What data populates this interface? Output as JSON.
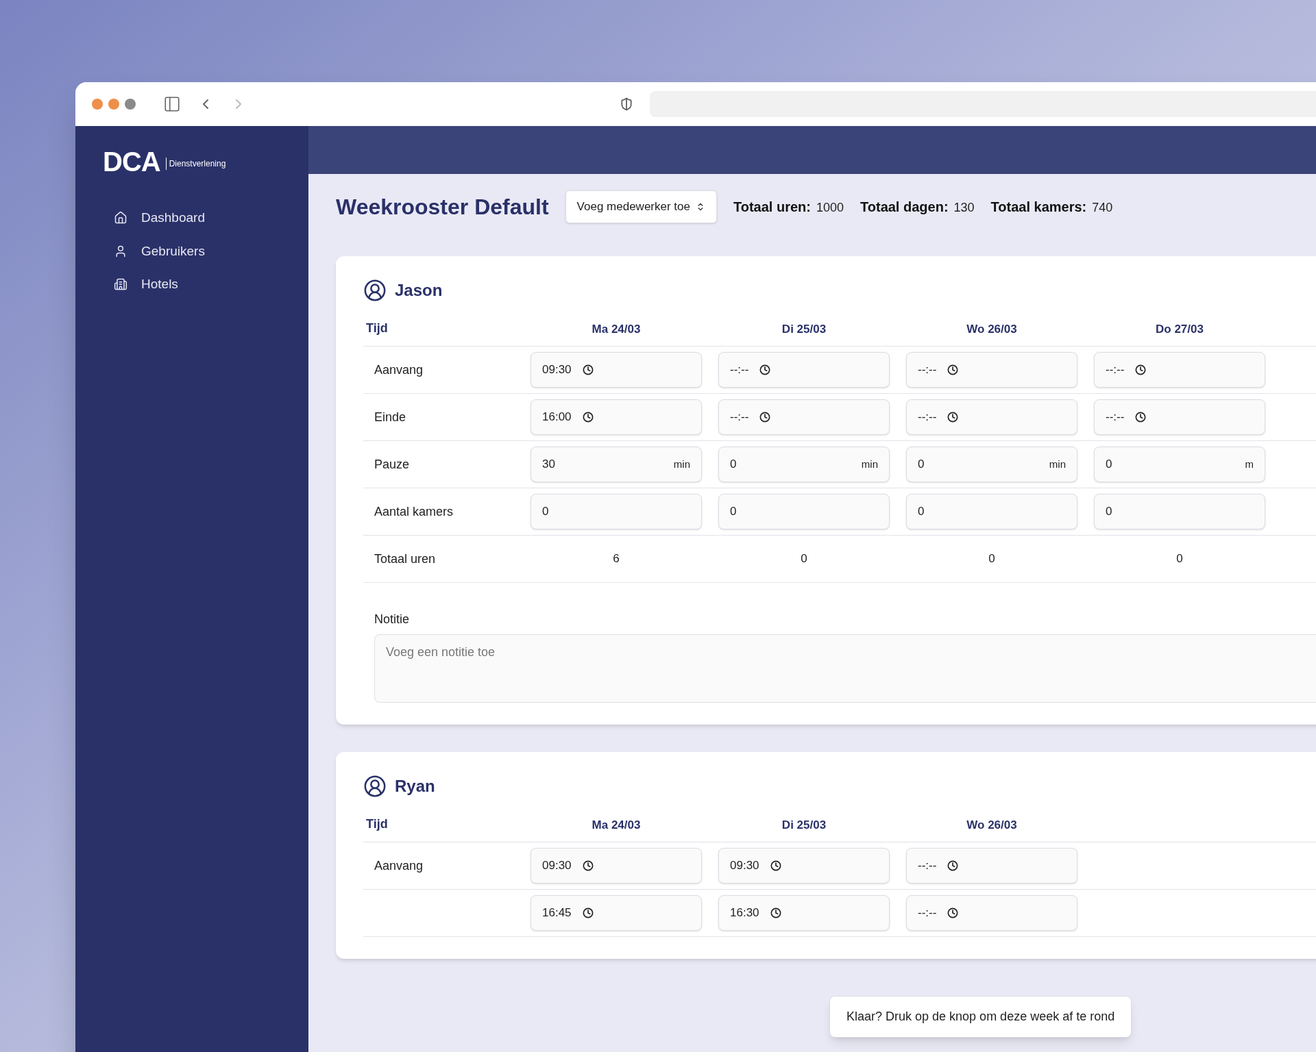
{
  "sidebar": {
    "logo": {
      "mark": "DCA",
      "tagline": "Dienstverlening"
    },
    "items": [
      {
        "label": "Dashboard",
        "kind": "home"
      },
      {
        "label": "Gebruikers",
        "kind": "user"
      },
      {
        "label": "Hotels",
        "kind": "building"
      }
    ]
  },
  "header": {
    "title": "Weekrooster Default",
    "select": "Voeg medewerker toe",
    "stats": [
      {
        "label": "Totaal uren:",
        "value": "1000"
      },
      {
        "label": "Totaal dagen:",
        "value": "130"
      },
      {
        "label": "Totaal kamers:",
        "value": "740"
      }
    ]
  },
  "employees": [
    {
      "name": "Jason",
      "corner": "Tijd",
      "days": [
        "Ma 24/03",
        "Di 25/03",
        "Wo 26/03",
        "Do 27/03"
      ],
      "rows": [
        {
          "label": "Aanvang",
          "kind": "time",
          "cells": [
            {
              "value": "09:30"
            },
            {
              "value": "--:--"
            },
            {
              "value": "--:--"
            },
            {
              "value": "--:--"
            }
          ]
        },
        {
          "label": "Einde",
          "kind": "time",
          "cells": [
            {
              "value": "16:00"
            },
            {
              "value": "--:--"
            },
            {
              "value": "--:--"
            },
            {
              "value": "--:--"
            }
          ]
        },
        {
          "label": "Pauze",
          "kind": "number",
          "cells": [
            {
              "value": "30",
              "unit": "min"
            },
            {
              "value": "0",
              "unit": "min"
            },
            {
              "value": "0",
              "unit": "min"
            },
            {
              "value": "0",
              "unit": "m"
            }
          ]
        },
        {
          "label": "Aantal kamers",
          "kind": "number",
          "cells": [
            {
              "value": "0"
            },
            {
              "value": "0"
            },
            {
              "value": "0"
            },
            {
              "value": "0"
            }
          ]
        },
        {
          "label": "Totaal uren",
          "kind": "total",
          "cells": [
            {
              "value": "6"
            },
            {
              "value": "0"
            },
            {
              "value": "0"
            },
            {
              "value": "0"
            }
          ]
        }
      ],
      "note": {
        "label": "Notitie",
        "placeholder": "Voeg een notitie toe"
      }
    },
    {
      "name": "Ryan",
      "corner": "Tijd",
      "days": [
        "Ma 24/03",
        "Di 25/03",
        "Wo 26/03"
      ],
      "rows": [
        {
          "label": "Aanvang",
          "kind": "time",
          "cells": [
            {
              "value": "09:30"
            },
            {
              "value": "09:30"
            },
            {
              "value": "--:--"
            }
          ]
        },
        {
          "kind": "time",
          "cells": [
            {
              "value": "16:45"
            },
            {
              "value": "16:30"
            },
            {
              "value": "--:--"
            }
          ]
        }
      ]
    }
  ],
  "tooltip": {
    "text": "Klaar? Druk op de knop om deze week af te rond"
  }
}
